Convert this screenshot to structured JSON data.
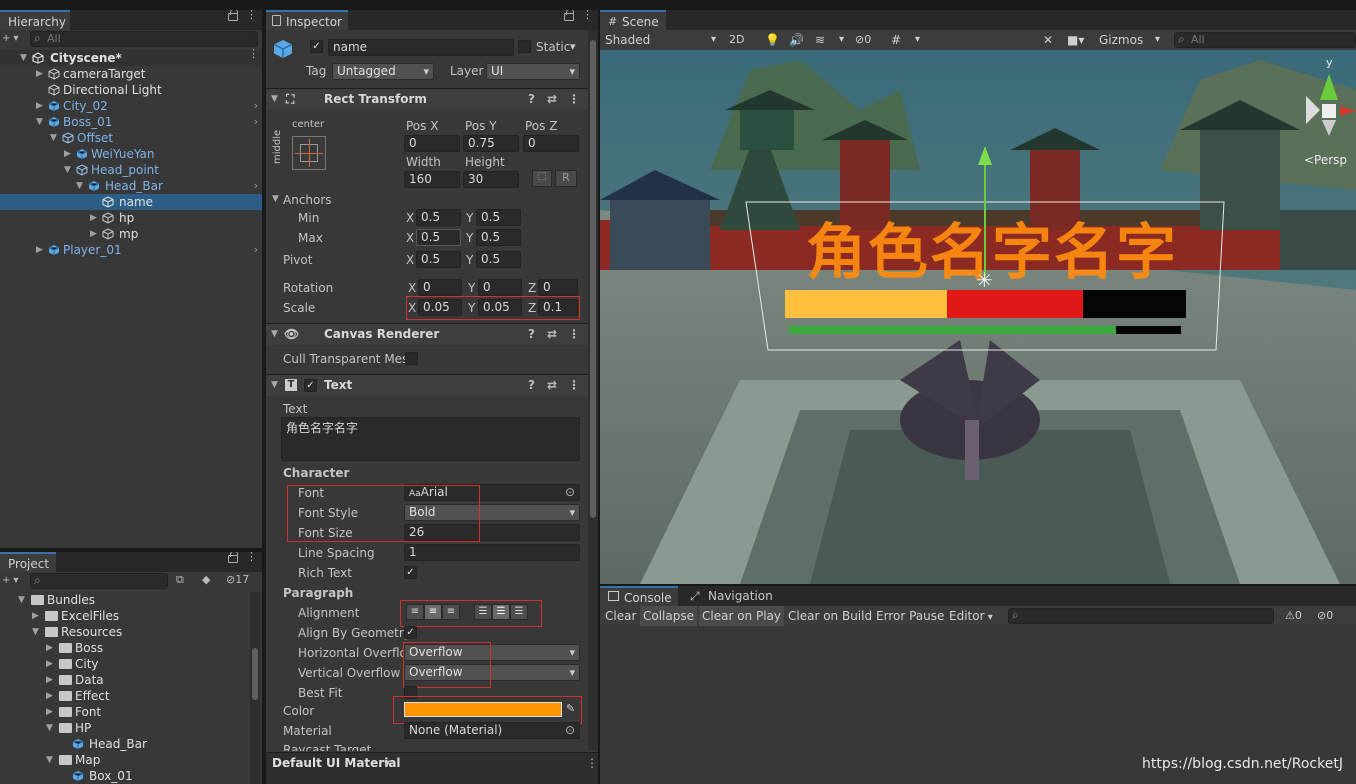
{
  "hierarchy": {
    "tab": "Hierarchy",
    "search_placeholder": "All",
    "items": [
      {
        "label": "Cityscene*"
      },
      {
        "label": "cameraTarget"
      },
      {
        "label": "Directional Light"
      },
      {
        "label": "City_02"
      },
      {
        "label": "Boss_01"
      },
      {
        "label": "Offset"
      },
      {
        "label": "WeiYueYan"
      },
      {
        "label": "Head_point"
      },
      {
        "label": "Head_Bar"
      },
      {
        "label": "name"
      },
      {
        "label": "hp"
      },
      {
        "label": "mp"
      },
      {
        "label": "Player_01"
      }
    ]
  },
  "project": {
    "tab": "Project",
    "hidden_count": "17",
    "items": [
      {
        "label": "Bundles"
      },
      {
        "label": "ExcelFiles"
      },
      {
        "label": "Resources"
      },
      {
        "label": "Boss"
      },
      {
        "label": "City"
      },
      {
        "label": "Data"
      },
      {
        "label": "Effect"
      },
      {
        "label": "Font"
      },
      {
        "label": "HP"
      },
      {
        "label": "Head_Bar"
      },
      {
        "label": "Map"
      },
      {
        "label": "Box_01"
      }
    ]
  },
  "inspector": {
    "tab": "Inspector",
    "object_name": "name",
    "static_label": "Static",
    "tag_label": "Tag",
    "tag_value": "Untagged",
    "layer_label": "Layer",
    "layer_value": "UI",
    "rect_transform": {
      "title": "Rect Transform",
      "anchor_h": "center",
      "anchor_v": "middle",
      "posx_label": "Pos X",
      "posy_label": "Pos Y",
      "posz_label": "Pos Z",
      "posx": "0",
      "posy": "0.75",
      "posz": "0",
      "width_label": "Width",
      "height_label": "Height",
      "width": "160",
      "height": "30",
      "r_button": "R",
      "anchors_label": "Anchors",
      "min_label": "Min",
      "max_label": "Max",
      "min_x": "0.5",
      "min_y": "0.5",
      "max_x": "0.5",
      "max_y": "0.5",
      "pivot_label": "Pivot",
      "pivot_x": "0.5",
      "pivot_y": "0.5",
      "rotation_label": "Rotation",
      "rot_x": "0",
      "rot_y": "0",
      "rot_z": "0",
      "scale_label": "Scale",
      "scale_x": "0.05",
      "scale_y": "0.05",
      "scale_z": "0.1",
      "x": "X",
      "y": "Y",
      "z": "Z"
    },
    "canvas_renderer": {
      "title": "Canvas Renderer",
      "cull_label": "Cull Transparent Mes"
    },
    "text": {
      "title": "Text",
      "text_label": "Text",
      "text_value": "角色名字名字",
      "character_label": "Character",
      "font_label": "Font",
      "font_value": "Arial",
      "font_prefix": "Aa",
      "font_style_label": "Font Style",
      "font_style_value": "Bold",
      "font_size_label": "Font Size",
      "font_size_value": "26",
      "line_spacing_label": "Line Spacing",
      "line_spacing_value": "1",
      "rich_text_label": "Rich Text",
      "paragraph_label": "Paragraph",
      "alignment_label": "Alignment",
      "align_geometry_label": "Align By Geometry",
      "h_overflow_label": "Horizontal Overflo",
      "h_overflow_value": "Overflow",
      "v_overflow_label": "Vertical Overflow",
      "v_overflow_value": "Overflow",
      "best_fit_label": "Best Fit",
      "color_label": "Color",
      "color_value": "#ff9500",
      "material_label": "Material",
      "material_value": "None (Material)",
      "raycast_label": "Raycast Target"
    },
    "footer_material": "Default UI Material"
  },
  "scene": {
    "tab": "Scene",
    "shading": "Shaded",
    "mode_2d": "2D",
    "hidden_count": "0",
    "gizmos": "Gizmos",
    "search_placeholder": "All",
    "axis_y": "y",
    "persp": "<Persp",
    "ui_text": "角色名字名字"
  },
  "console": {
    "tab": "Console",
    "nav_tab": "Navigation",
    "buttons": [
      "Clear",
      "Collapse",
      "Clear on Play",
      "Clear on Build",
      "Error Pause",
      "Editor"
    ],
    "warn_count": "0",
    "err_count": "0"
  },
  "watermark": "https://blog.csdn.net/RocketJ",
  "colors": {
    "accent": "#2c5d87",
    "prefab": "#7eb2e8",
    "text_color": "#ff9500",
    "highlight": "#d43030"
  }
}
